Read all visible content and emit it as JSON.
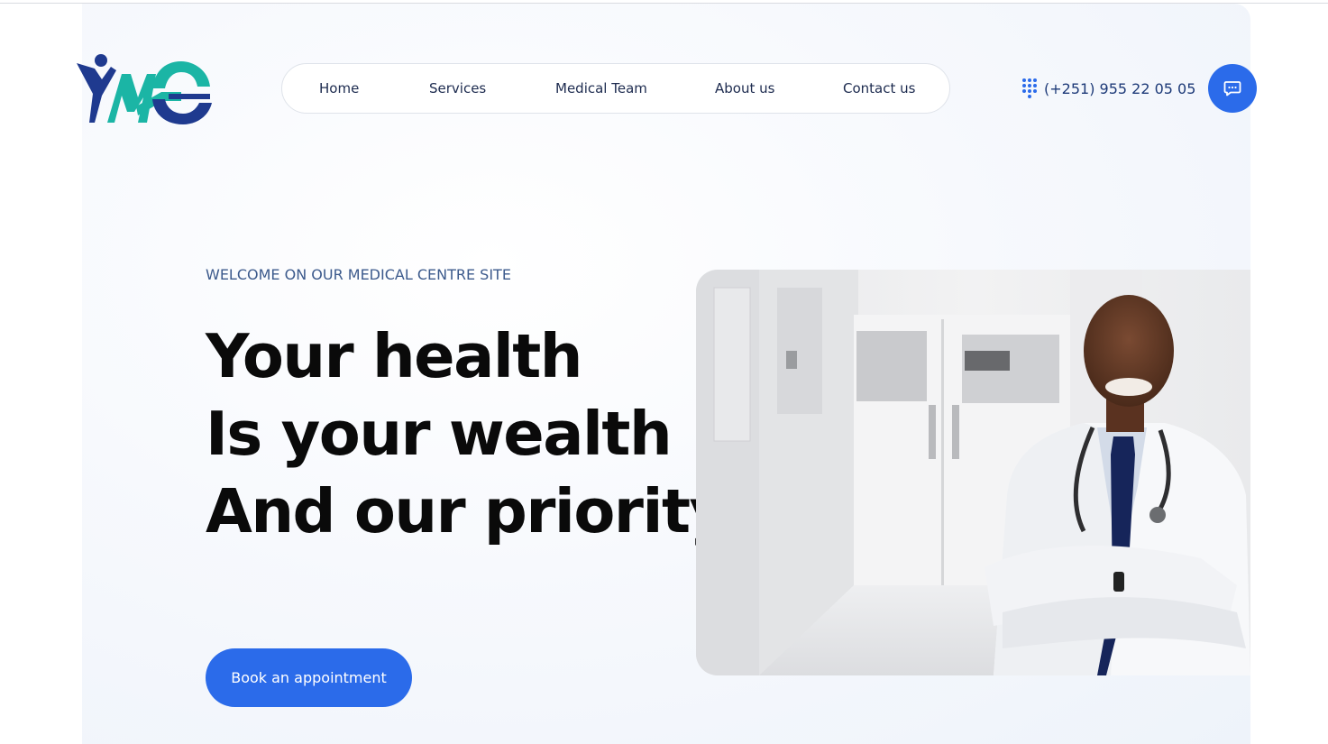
{
  "nav": {
    "items": [
      {
        "label": "Home"
      },
      {
        "label": "Services"
      },
      {
        "label": "Medical Team"
      },
      {
        "label": "About us"
      },
      {
        "label": "Contact us"
      }
    ]
  },
  "contact": {
    "phone": "(+251) 955 22 05 05",
    "phone_icon": "dial-pad-icon",
    "chat_icon": "chat-bubble-icon"
  },
  "logo": {
    "text": "YMC",
    "icon": "ymc-logo"
  },
  "hero": {
    "eyebrow": "WELCOME ON OUR MEDICAL CENTRE SITE",
    "headline_lines": [
      "Your health",
      "Is your wealth",
      "And our priority"
    ],
    "cta_label": "Book an appointment",
    "image": "doctor-in-hospital-corridor-photo"
  },
  "colors": {
    "accent": "#2b6bea",
    "nav_text": "#1d2b4f",
    "eyebrow": "#3c5a8c",
    "logo_navy": "#1f3a8f",
    "logo_teal": "#1bb5a5"
  }
}
